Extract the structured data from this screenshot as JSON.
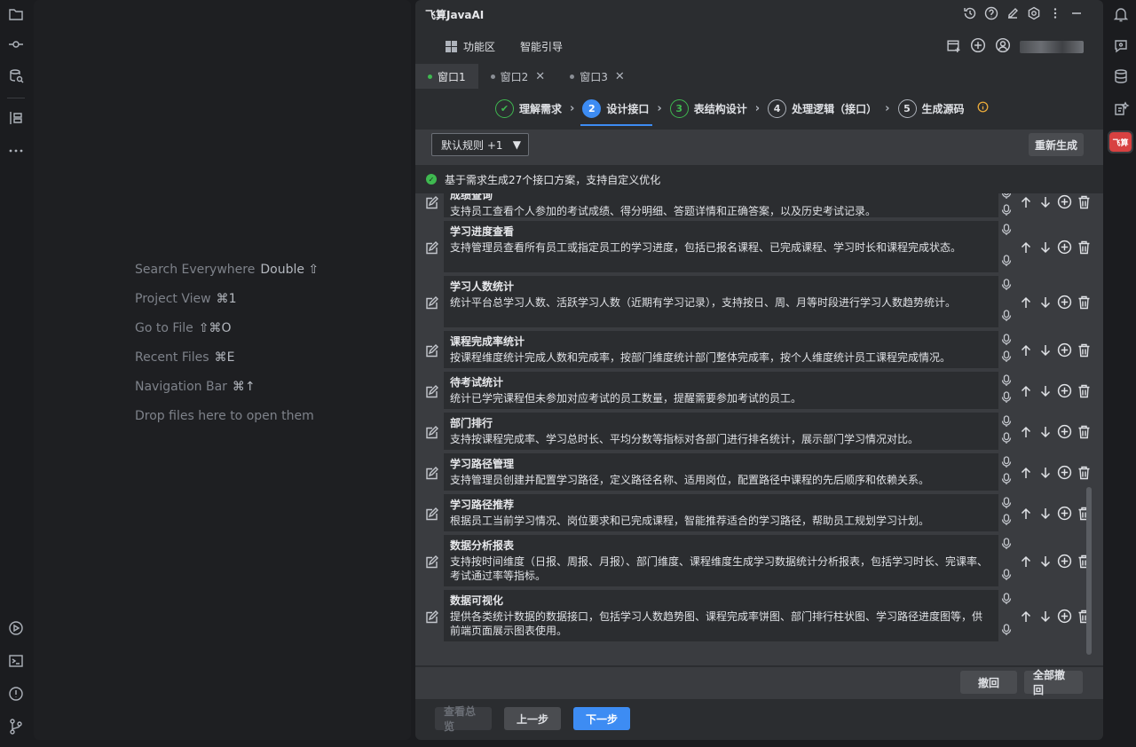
{
  "editor": {
    "hints": [
      {
        "text": "Search Everywhere",
        "key": "Double ⇧"
      },
      {
        "text": "Project View",
        "key": "⌘1"
      },
      {
        "text": "Go to File",
        "key": "⇧⌘O"
      },
      {
        "text": "Recent Files",
        "key": "⌘E"
      },
      {
        "text": "Navigation Bar",
        "key": "⌘↑"
      },
      {
        "text": "Drop files here to open them",
        "key": ""
      }
    ]
  },
  "panel": {
    "title": "飞算JavaAI",
    "menu": {
      "features": "功能区",
      "guide": "智能引导"
    },
    "tabs": [
      {
        "label": "窗口1"
      },
      {
        "label": "窗口2"
      },
      {
        "label": "窗口3"
      }
    ],
    "steps": [
      {
        "num": "✔",
        "label": "理解需求"
      },
      {
        "num": "2",
        "label": "设计接口"
      },
      {
        "num": "3",
        "label": "表结构设计"
      },
      {
        "num": "4",
        "label": "处理逻辑（接口）"
      },
      {
        "num": "5",
        "label": "生成源码"
      }
    ],
    "rule_select": "默认规则 +1",
    "regenerate": "重新生成",
    "banner": "基于需求生成27个接口方案，支持自定义优化",
    "items": [
      {
        "name": "成绩查询",
        "desc": "支持员工查看个人参加的考试成绩、得分明细、答题详情和正确答案，以及历史考试记录。"
      },
      {
        "name": "学习进度查看",
        "desc": "支持管理员查看所有员工或指定员工的学习进度，包括已报名课程、已完成课程、学习时长和课程完成状态。"
      },
      {
        "name": "学习人数统计",
        "desc": "统计平台总学习人数、活跃学习人数（近期有学习记录），支持按日、周、月等时段进行学习人数趋势统计。"
      },
      {
        "name": "课程完成率统计",
        "desc": "按课程维度统计完成人数和完成率，按部门维度统计部门整体完成率，按个人维度统计员工课程完成情况。"
      },
      {
        "name": "待考试统计",
        "desc": "统计已学完课程但未参加对应考试的员工数量，提醒需要参加考试的员工。"
      },
      {
        "name": "部门排行",
        "desc": "支持按课程完成率、学习总时长、平均分数等指标对各部门进行排名统计，展示部门学习情况对比。"
      },
      {
        "name": "学习路径管理",
        "desc": "支持管理员创建并配置学习路径，定义路径名称、适用岗位，配置路径中课程的先后顺序和依赖关系。"
      },
      {
        "name": "学习路径推荐",
        "desc": "根据员工当前学习情况、岗位要求和已完成课程，智能推荐适合的学习路径，帮助员工规划学习计划。"
      },
      {
        "name": "数据分析报表",
        "desc": "支持按时间维度（日报、周报、月报）、部门维度、课程维度生成学习数据统计分析报表，包括学习时长、完课率、考试通过率等指标。"
      },
      {
        "name": "数据可视化",
        "desc": "提供各类统计数据的数据接口，包括学习人数趋势图、课程完成率饼图、部门排行柱状图、学习路径进度图等，供前端页面展示图表使用。"
      }
    ],
    "undo": "撤回",
    "undo_all": "全部撤回",
    "preview": "查看总览",
    "prev": "上一步",
    "next": "下一步"
  },
  "right_badge": "飞算",
  "colors": {
    "accent": "#3d8cf3",
    "success": "#3fb950",
    "warning": "#e8a93a",
    "brand": "#d84141"
  }
}
